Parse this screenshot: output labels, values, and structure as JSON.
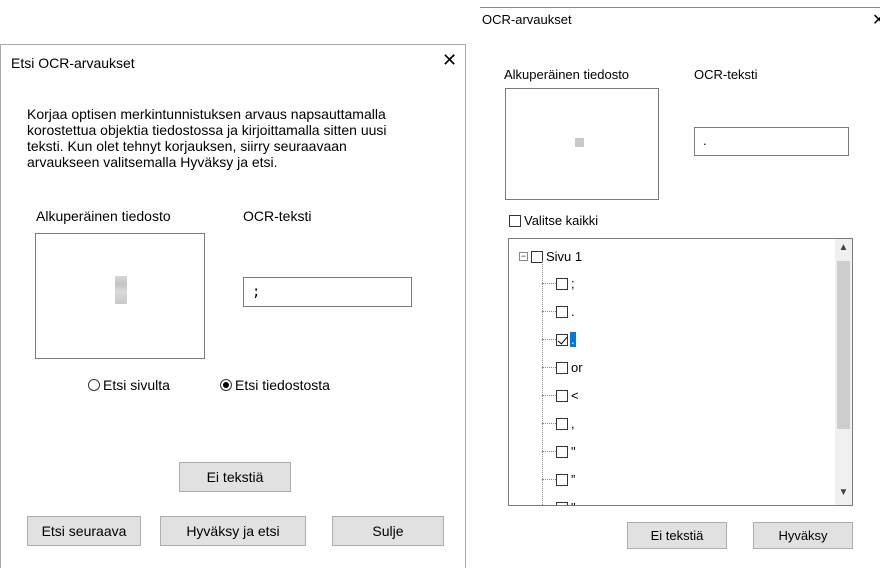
{
  "dialog1": {
    "title": "Etsi OCR-arvaukset",
    "close_icon": "close-icon",
    "instructions_line1": "Korjaa optisen merkintunnistuksen arvaus napsauttamalla",
    "instructions_line2": "korostettua objektia tiedostossa ja kirjoittamalla sitten uusi",
    "instructions_line3": "teksti. Kun olet tehnyt korjauksen, siirry seuraavaan",
    "instructions_line4": "arvaukseen valitsemalla Hyväksy ja etsi.",
    "original_label": "Alkuperäinen tiedosto",
    "ocr_label": "OCR-teksti",
    "ocr_value": ";",
    "radio_page": "Etsi sivulta",
    "radio_file": "Etsi tiedostosta",
    "radio_selected": "Etsi tiedostosta",
    "btn_no_text": "Ei tekstiä",
    "btn_find_next": "Etsi seuraava",
    "btn_accept_find": "Hyväksy ja etsi",
    "btn_close": "Sulje"
  },
  "dialog2": {
    "title": "OCR-arvaukset",
    "close_icon": "close-icon",
    "original_label": "Alkuperäinen tiedosto",
    "ocr_label": "OCR-teksti",
    "ocr_value": ".",
    "select_all": "Valitse kaikki",
    "tree_root": "Sivu 1",
    "tree_items": [
      {
        "text": ";",
        "checked": false,
        "selected": false
      },
      {
        "text": ".",
        "checked": false,
        "selected": false
      },
      {
        "text": ".",
        "checked": true,
        "selected": true
      },
      {
        "text": "or",
        "checked": false,
        "selected": false
      },
      {
        "text": "<",
        "checked": false,
        "selected": false
      },
      {
        "text": ",",
        "checked": false,
        "selected": false
      },
      {
        "text": "\"",
        "checked": false,
        "selected": false
      },
      {
        "text": "”",
        "checked": false,
        "selected": false
      },
      {
        "text": "\"",
        "checked": false,
        "selected": false
      }
    ],
    "btn_no_text": "Ei tekstiä",
    "btn_accept": "Hyväksy"
  },
  "colors": {
    "selection": "#0078d7",
    "button_face": "#e1e1e1",
    "scroll_thumb": "#cdcdcd"
  }
}
